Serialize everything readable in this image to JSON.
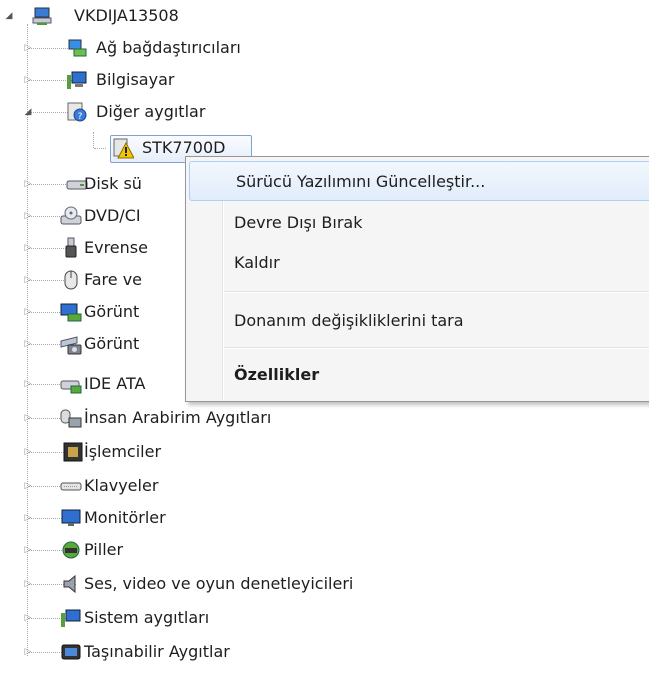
{
  "root": {
    "label": "VKDIJA13508",
    "expanded": true,
    "icon": "computer-network-icon"
  },
  "categories": [
    {
      "label": "Ağ bağdaştırıcıları",
      "icon": "network-adapter-icon",
      "expanded": false
    },
    {
      "label": "Bilgisayar",
      "icon": "computer-icon",
      "expanded": false
    },
    {
      "label": "Diğer aygıtlar",
      "icon": "unknown-device-icon",
      "expanded": true,
      "children": [
        {
          "label": "STK7700D",
          "icon": "warning-device-icon",
          "selected": true
        }
      ]
    },
    {
      "label": "Disk sü",
      "icon": "disk-drive-icon",
      "expanded": false
    },
    {
      "label": "DVD/CI",
      "icon": "dvd-drive-icon",
      "expanded": false
    },
    {
      "label": "Evrense",
      "icon": "usb-icon",
      "expanded": false
    },
    {
      "label": "Fare ve",
      "icon": "mouse-icon",
      "expanded": false
    },
    {
      "label": "Görünt",
      "icon": "display-adapter-icon",
      "expanded": false
    },
    {
      "label": "Görünt",
      "icon": "imaging-device-icon",
      "expanded": false
    },
    {
      "label": "IDE ATA",
      "icon": "ide-controller-icon",
      "expanded": false
    },
    {
      "label": "İnsan Arabirim Aygıtları",
      "icon": "hid-icon",
      "expanded": false
    },
    {
      "label": "İşlemciler",
      "icon": "processor-icon",
      "expanded": false
    },
    {
      "label": "Klavyeler",
      "icon": "keyboard-icon",
      "expanded": false
    },
    {
      "label": "Monitörler",
      "icon": "monitor-icon",
      "expanded": false
    },
    {
      "label": "Piller",
      "icon": "battery-icon",
      "expanded": false
    },
    {
      "label": "Ses, video ve oyun denetleyicileri",
      "icon": "speaker-icon",
      "expanded": false
    },
    {
      "label": "Sistem aygıtları",
      "icon": "system-device-icon",
      "expanded": false
    },
    {
      "label": "Taşınabilir Aygıtlar",
      "icon": "portable-device-icon",
      "expanded": false
    }
  ],
  "context_menu": {
    "items": [
      {
        "label": "Sürücü Yazılımını Güncelleştir...",
        "hover": true
      },
      {
        "label": "Devre Dışı Bırak"
      },
      {
        "label": "Kaldır"
      },
      {
        "label": "Donanım değişikliklerini tara"
      },
      {
        "label": "Özellikler",
        "bold": true
      }
    ]
  },
  "colors": {
    "selection_border": "#7da2ce",
    "menu_hover_border": "#aecff7",
    "menu_bg": "#f5f5f5"
  }
}
